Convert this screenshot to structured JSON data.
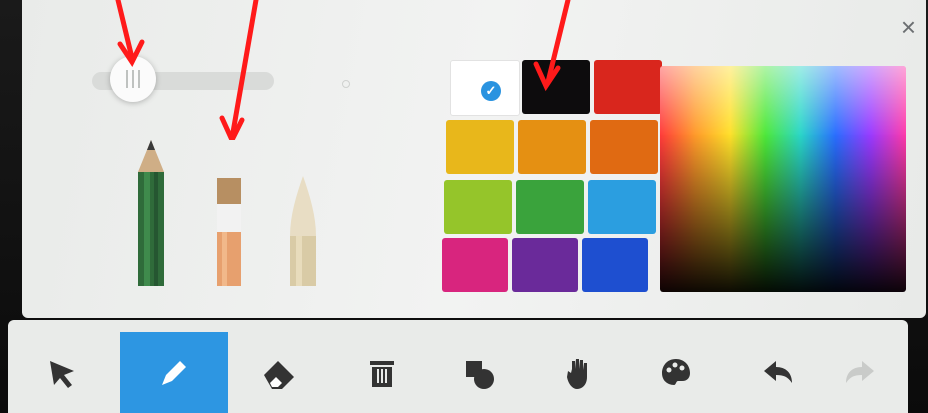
{
  "panel": {
    "close_label": "×",
    "size_slider": {
      "value": 0.2
    },
    "tools": [
      {
        "name": "pencil-icon"
      },
      {
        "name": "brush-icon"
      },
      {
        "name": "calligraphy-brush-icon"
      }
    ],
    "palette": {
      "selected": "white",
      "swatches": [
        "#ffffff",
        "#0d0c0d",
        "#d9261d",
        "#e8b71b",
        "#e59012",
        "#e06a12",
        "#95c52a",
        "#3aa33c",
        "#2b9ee0",
        "#d8257e",
        "#6a2a9a",
        "#1e4fd0"
      ]
    },
    "spectrum": {
      "name": "color-spectrum"
    }
  },
  "toolbar": {
    "active_color": "#2d96e2",
    "buttons": [
      {
        "name": "select-icon"
      },
      {
        "name": "pen-icon"
      },
      {
        "name": "eraser-icon"
      },
      {
        "name": "trash-icon"
      },
      {
        "name": "shapes-icon"
      },
      {
        "name": "hand-icon"
      },
      {
        "name": "palette-icon"
      },
      {
        "name": "undo-icon"
      },
      {
        "name": "redo-icon"
      }
    ]
  },
  "annotation_color": "#ff1a1a"
}
